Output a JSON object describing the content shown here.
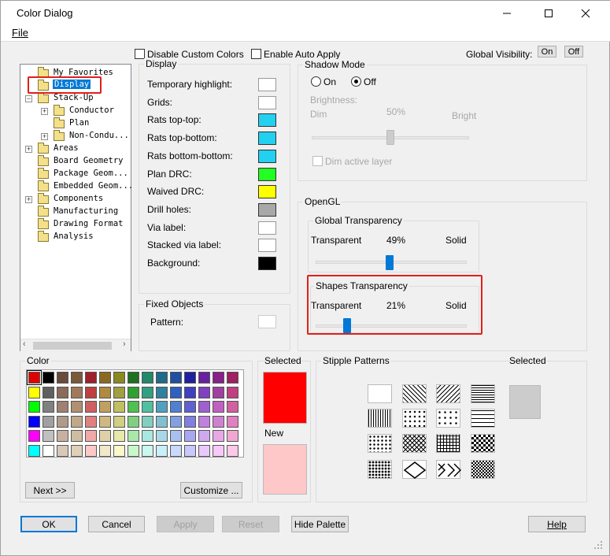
{
  "window": {
    "title": "Color Dialog",
    "menu_file": "File",
    "minimize_icon": "minimize-icon",
    "maximize_icon": "maximize-icon",
    "close_icon": "close-icon"
  },
  "top_options": {
    "disable_custom_colors": "Disable Custom Colors",
    "enable_auto_apply": "Enable Auto Apply",
    "global_visibility": "Global Visibility:",
    "on": "On",
    "off": "Off"
  },
  "tree": {
    "items": [
      {
        "label": "My Favorites"
      },
      {
        "label": "Display",
        "selected": true
      },
      {
        "label": "Stack-Up"
      },
      {
        "label": "Conductor"
      },
      {
        "label": "Plan"
      },
      {
        "label": "Non-Condu..."
      },
      {
        "label": "Areas"
      },
      {
        "label": "Board Geometry"
      },
      {
        "label": "Package Geom..."
      },
      {
        "label": "Embedded Geom..."
      },
      {
        "label": "Components"
      },
      {
        "label": "Manufacturing"
      },
      {
        "label": "Drawing Format"
      },
      {
        "label": "Analysis"
      }
    ]
  },
  "display": {
    "title": "Display",
    "rows": [
      {
        "label": "Temporary highlight:",
        "color": "#ffffff"
      },
      {
        "label": "Grids:",
        "color": "#ffffff"
      },
      {
        "label": "Rats top-top:",
        "color": "#22d0f0"
      },
      {
        "label": "Rats top-bottom:",
        "color": "#22d0f0"
      },
      {
        "label": "Rats bottom-bottom:",
        "color": "#22d0f0"
      },
      {
        "label": "Plan DRC:",
        "color": "#22ff22"
      },
      {
        "label": "Waived DRC:",
        "color": "#ffff00"
      },
      {
        "label": "Drill holes:",
        "color": "#a8a8a8"
      },
      {
        "label": "Via label:",
        "color": "#ffffff"
      },
      {
        "label": "Stacked via label:",
        "color": "#ffffff"
      },
      {
        "label": "Background:",
        "color": "#000000"
      }
    ]
  },
  "fixed_objects": {
    "title": "Fixed Objects",
    "pattern_label": "Pattern:"
  },
  "shadow_mode": {
    "title": "Shadow Mode",
    "on": "On",
    "off": "Off",
    "selected": "Off",
    "brightness": "Brightness:",
    "dim": "Dim",
    "percent": "50%",
    "bright": "Bright",
    "brightness_value": 0.5,
    "dim_active_layer": "Dim active layer"
  },
  "opengl": {
    "title": "OpenGL",
    "global": {
      "title": "Global Transparency",
      "transparent": "Transparent",
      "percent": "49%",
      "solid": "Solid",
      "value": 0.49
    },
    "shapes": {
      "title": "Shapes Transparency",
      "transparent": "Transparent",
      "percent": "21%",
      "solid": "Solid",
      "value": 0.21
    }
  },
  "color": {
    "title": "Color",
    "palette": [
      [
        "#e00000",
        "#000000",
        "#6b4b3b",
        "#7b5a3a",
        "#a0202a",
        "#8b6a20",
        "#8a8a20",
        "#207020",
        "#208a6a",
        "#206a8a",
        "#2050a0",
        "#2020a0",
        "#6a20a0",
        "#8a208a",
        "#a02060"
      ],
      [
        "#ffff00",
        "#606060",
        "#8a6a5a",
        "#a07a5a",
        "#c04040",
        "#b08a40",
        "#a0a040",
        "#30a030",
        "#30a080",
        "#3080a0",
        "#3060c0",
        "#4040c0",
        "#8040c0",
        "#a040a0",
        "#c04080"
      ],
      [
        "#00ff00",
        "#808080",
        "#a08070",
        "#b09070",
        "#d06060",
        "#c0a060",
        "#c0c060",
        "#50c050",
        "#50c0a0",
        "#50a0c0",
        "#5080d0",
        "#6060d0",
        "#a060d0",
        "#c060c0",
        "#d060a0"
      ],
      [
        "#0000ff",
        "#a0a0a0",
        "#b09a8a",
        "#c0a88a",
        "#e08080",
        "#d0b880",
        "#d0d080",
        "#80d080",
        "#80d0c0",
        "#80c0d0",
        "#80a0e0",
        "#8080e0",
        "#c080e0",
        "#d080d0",
        "#e080c0"
      ],
      [
        "#ff00ff",
        "#c0c0c0",
        "#c8b0a0",
        "#d0bca0",
        "#f0a8a8",
        "#e0d0a8",
        "#e8e8a8",
        "#a8e8a8",
        "#a8e8e0",
        "#a8d8e8",
        "#a8c0f0",
        "#a8a8f0",
        "#d0a8f0",
        "#e8a8e8",
        "#f0a8d0"
      ],
      [
        "#00ffff",
        "#ffffff",
        "#d8c8b8",
        "#e0d0b8",
        "#ffc8c8",
        "#f0e8c8",
        "#f8f8c8",
        "#c8f8c8",
        "#c8f8f0",
        "#c8f0f8",
        "#c8d8ff",
        "#c8c8ff",
        "#e8c8ff",
        "#f8c8f8",
        "#ffc8e8"
      ]
    ],
    "next_button": "Next >>",
    "customize_button": "Customize ..."
  },
  "selected_panel": {
    "selected_label": "Selected",
    "selected_color": "#ff0000",
    "new_label": "New",
    "new_color": "#ffc8c8"
  },
  "stipple": {
    "title": "Stipple Patterns",
    "selected_label": "Selected"
  },
  "buttons": {
    "ok": "OK",
    "cancel": "Cancel",
    "apply": "Apply",
    "reset": "Reset",
    "hide_palette": "Hide Palette",
    "help": "Help"
  }
}
